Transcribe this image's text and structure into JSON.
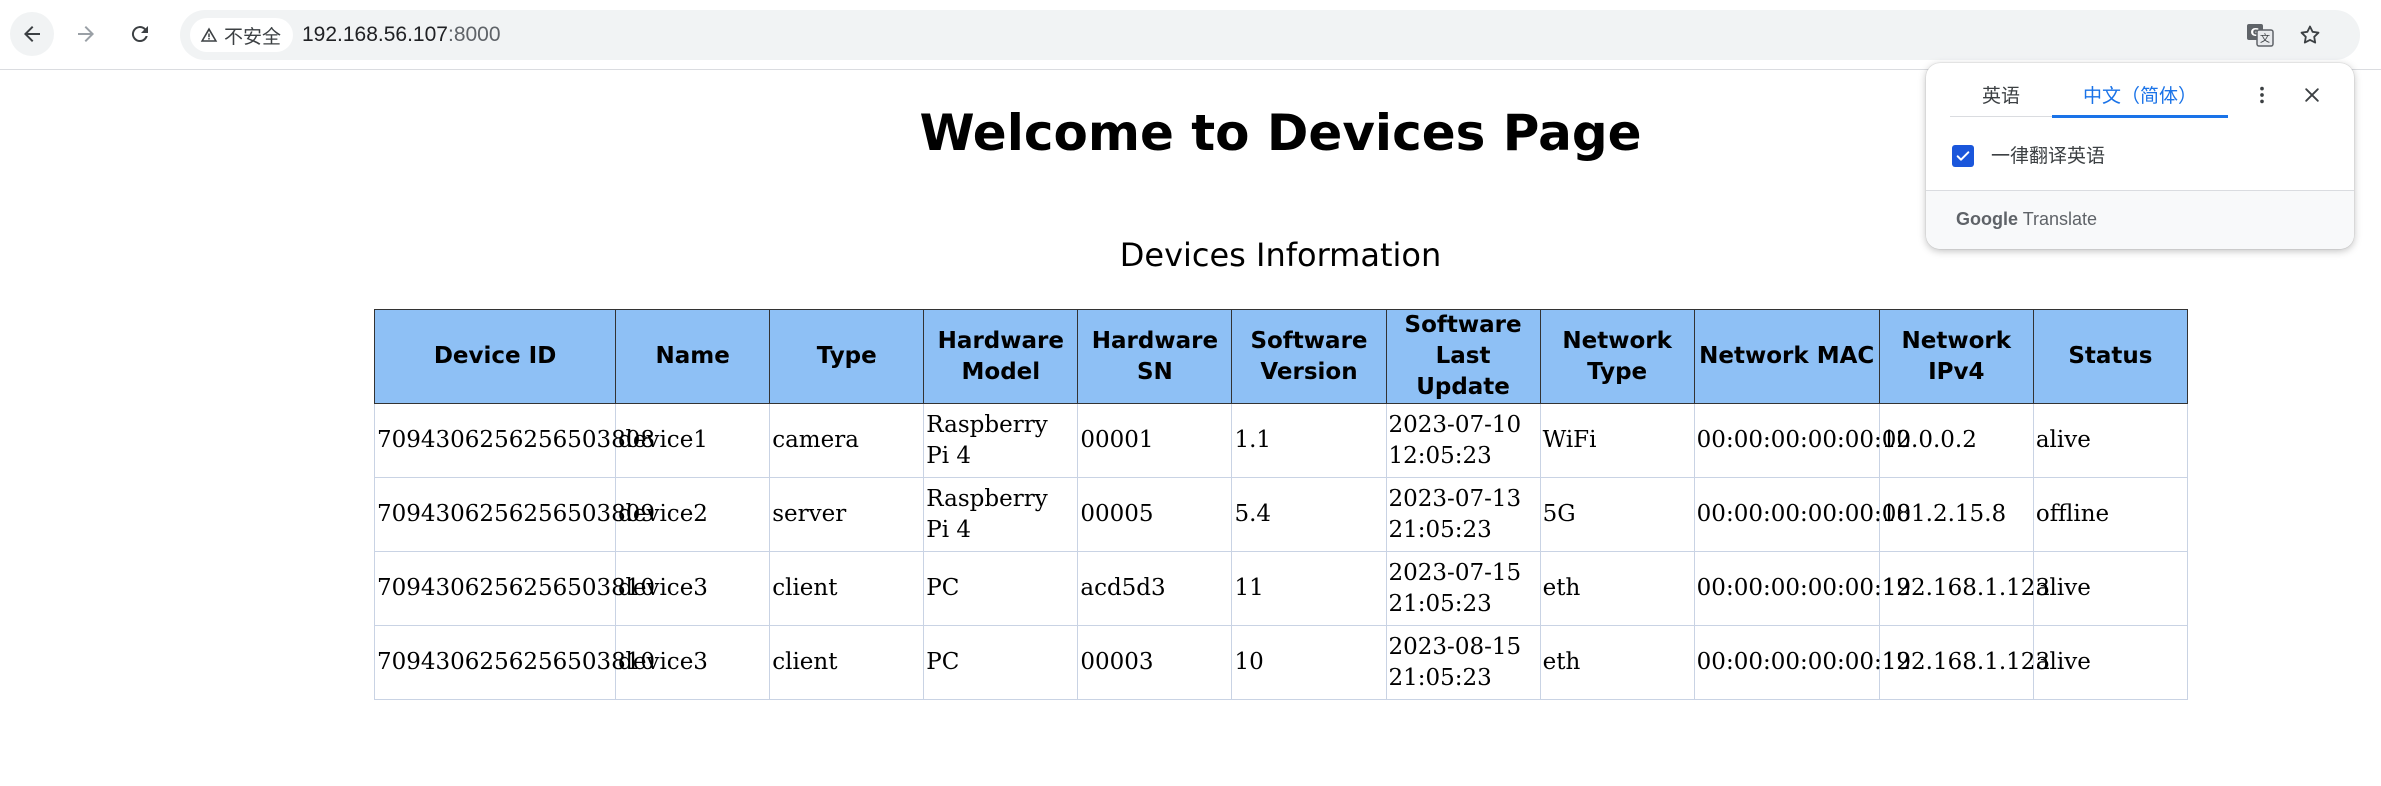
{
  "browser": {
    "security_label": "不安全",
    "url_host": "192.168.56.107",
    "url_port": ":8000"
  },
  "page": {
    "title": "Welcome to Devices Page",
    "subtitle": "Devices Information"
  },
  "table": {
    "headers": [
      "Device ID",
      "Name",
      "Type",
      "Hardware Model",
      "Hardware SN",
      "Software Version",
      "Software Last Update",
      "Network Type",
      "Network MAC",
      "Network IPv4",
      "Status"
    ],
    "rows": [
      [
        "7094306256256503808",
        "device1",
        "camera",
        "Raspberry Pi 4",
        "00001",
        "1.1",
        "2023-07-10 12:05:23",
        "WiFi",
        "00:00:00:00:00:02",
        "10.0.0.2",
        "alive"
      ],
      [
        "7094306256256503809",
        "device2",
        "server",
        "Raspberry Pi 4",
        "00005",
        "5.4",
        "2023-07-13 21:05:23",
        "5G",
        "00:00:00:00:00:08",
        "101.2.15.8",
        "offline"
      ],
      [
        "7094306256256503810",
        "device3",
        "client",
        "PC",
        "acd5d3",
        "11",
        "2023-07-15 21:05:23",
        "eth",
        "00:00:00:00:00:12",
        "192.168.1.123",
        "alive"
      ],
      [
        "7094306256256503810",
        "device3",
        "client",
        "PC",
        "00003",
        "10",
        "2023-08-15 21:05:23",
        "eth",
        "00:00:00:00:00:12",
        "192.168.1.123",
        "alive"
      ]
    ]
  },
  "translate_popup": {
    "tab_source": "英语",
    "tab_target": "中文（简体）",
    "always_translate_label": "一律翻译英语",
    "always_translate_checked": true,
    "brand_google": "Google",
    "brand_translate": "Translate"
  },
  "icons": {
    "back": "arrow-left-icon",
    "forward": "arrow-right-icon",
    "reload": "reload-icon",
    "warning": "warning-triangle-icon",
    "translate": "translate-icon",
    "star": "star-icon",
    "more": "more-vertical-icon",
    "close": "close-icon",
    "check": "checkmark-icon"
  },
  "colors": {
    "header_bg": "#8ec0f5",
    "accent": "#1a73e8",
    "checkbox": "#1a56db"
  }
}
